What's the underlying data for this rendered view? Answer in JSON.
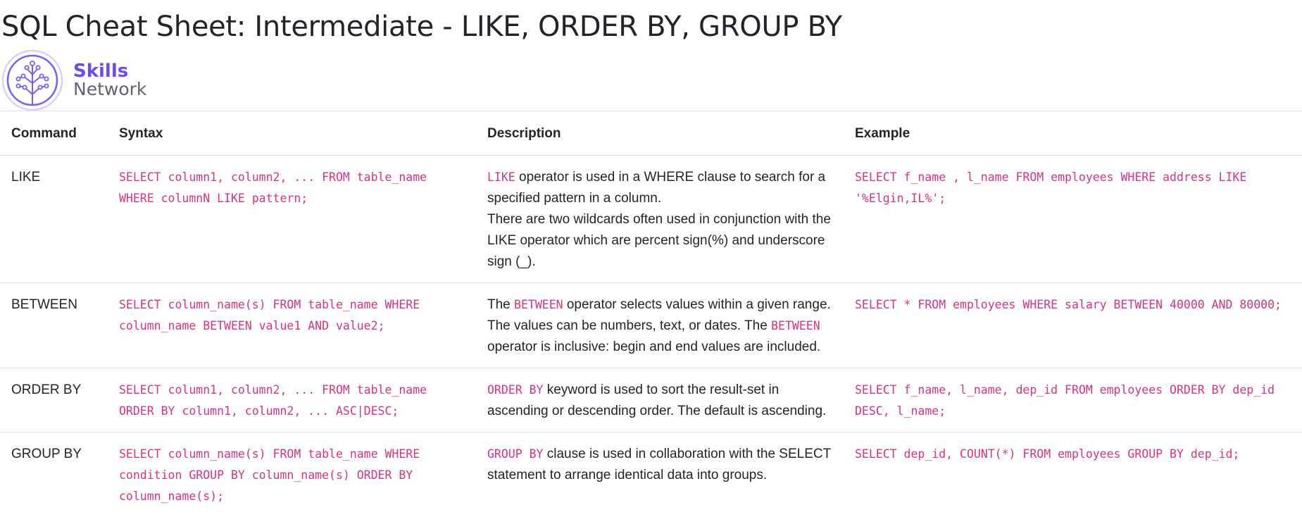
{
  "page": {
    "title": "SQL Cheat Sheet: Intermediate - LIKE, ORDER BY, GROUP BY"
  },
  "brand": {
    "line1": "Skills",
    "line2": "Network",
    "logo_icon": "skills-network-tree-logo",
    "accent_color": "#6c4cf2"
  },
  "table": {
    "headers": {
      "command": "Command",
      "syntax": "Syntax",
      "description": "Description",
      "example": "Example"
    },
    "rows": [
      {
        "command": "LIKE",
        "syntax": "SELECT column1, column2, ... FROM table_name WHERE columnN LIKE pattern;",
        "desc_code1": "LIKE",
        "desc_text1": " operator is used in a WHERE clause to search for a specified pattern in a column.",
        "desc_text2": "There are two wildcards often used in conjunction with the LIKE operator which are percent sign(%) and underscore sign (_).",
        "example": "SELECT f_name , l_name FROM employees WHERE address LIKE '%Elgin,IL%';"
      },
      {
        "command": "BETWEEN",
        "syntax": "SELECT column_name(s) FROM table_name WHERE column_name BETWEEN value1 AND value2;",
        "desc_text0": "The ",
        "desc_code1": "BETWEEN",
        "desc_text1": " operator selects values within a given range. The values can be numbers, text, or dates. The ",
        "desc_code2": "BETWEEN",
        "desc_text2": " operator is inclusive: begin and end values are included.",
        "example": "SELECT * FROM employees WHERE salary BETWEEN 40000 AND 80000;"
      },
      {
        "command": "ORDER BY",
        "syntax": "SELECT column1, column2, ... FROM table_name ORDER BY column1, column2, ... ASC|DESC;",
        "desc_code1": "ORDER BY",
        "desc_text1": " keyword is used to sort the result-set in ascending or descending order. The default is ascending.",
        "example": "SELECT f_name, l_name, dep_id FROM employees ORDER BY dep_id DESC, l_name;"
      },
      {
        "command": "GROUP BY",
        "syntax": "SELECT column_name(s) FROM table_name WHERE condition GROUP BY column_name(s) ORDER BY column_name(s);",
        "desc_code1": "GROUP BY",
        "desc_text1": " clause is used in collaboration with the SELECT statement to arrange identical data into groups.",
        "example": "SELECT dep_id, COUNT(*) FROM employees GROUP BY dep_id;"
      }
    ]
  },
  "colors": {
    "code": "#d63384",
    "text": "#212529",
    "border": "#dee2e6"
  }
}
